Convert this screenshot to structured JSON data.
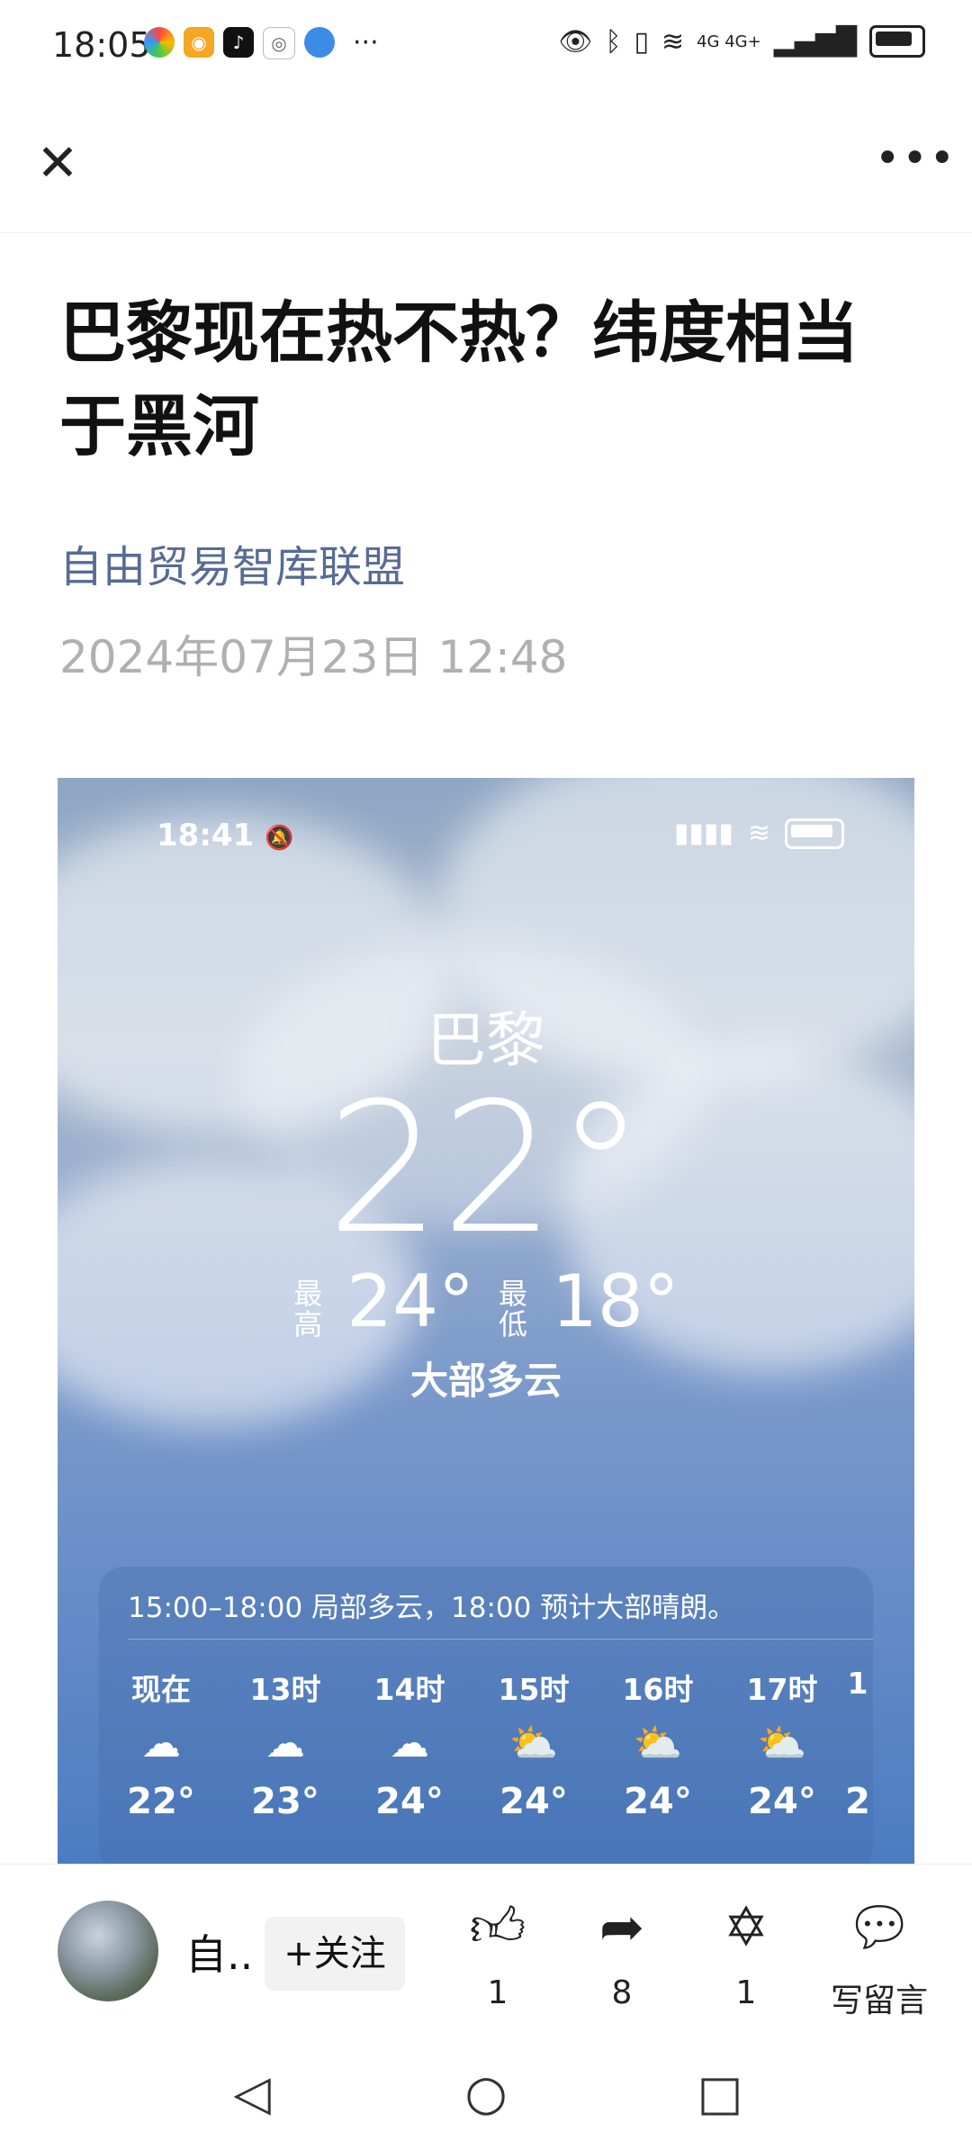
{
  "status_bar": {
    "time": "18:05",
    "more": "···",
    "app_icons": [
      "colorful-app-icon",
      "weibo-icon",
      "tiktok-icon",
      "wechat-icon",
      "browser-icon"
    ],
    "right_text": "4G 4G+"
  },
  "top_bar": {
    "close": "✕",
    "more": "•••"
  },
  "article": {
    "title": "巴黎现在热不热？纬度相当于黑河",
    "author": "自由贸易智库联盟",
    "date": "2024年07月23日 12:48"
  },
  "weather_shot": {
    "time": "18:41",
    "city": "巴黎",
    "temp": "22°",
    "high_label": "最高",
    "high": "24°",
    "low_label": "最低",
    "low": "18°",
    "condition": "大部多云",
    "forecast_text": "15:00–18:00 局部多云，18:00 预计大部晴朗。",
    "hours": [
      {
        "label": "现在",
        "icon": "cloud-icon",
        "temp": "22°"
      },
      {
        "label": "13时",
        "icon": "cloud-icon",
        "temp": "23°"
      },
      {
        "label": "14时",
        "icon": "cloud-icon",
        "temp": "24°"
      },
      {
        "label": "15时",
        "icon": "partly-sunny-icon",
        "temp": "24°"
      },
      {
        "label": "16时",
        "icon": "partly-sunny-icon",
        "temp": "24°"
      },
      {
        "label": "17时",
        "icon": "partly-sunny-icon",
        "temp": "24°"
      },
      {
        "label": "1",
        "icon": "",
        "temp": "2"
      }
    ]
  },
  "action_bar": {
    "account_name": "自..",
    "follow": "+关注",
    "like_count": "1",
    "share_count": "8",
    "wow_count": "1",
    "comment_label": "写留言"
  },
  "colors": {
    "author_link": "#576b95",
    "date": "#b0b0b0"
  }
}
